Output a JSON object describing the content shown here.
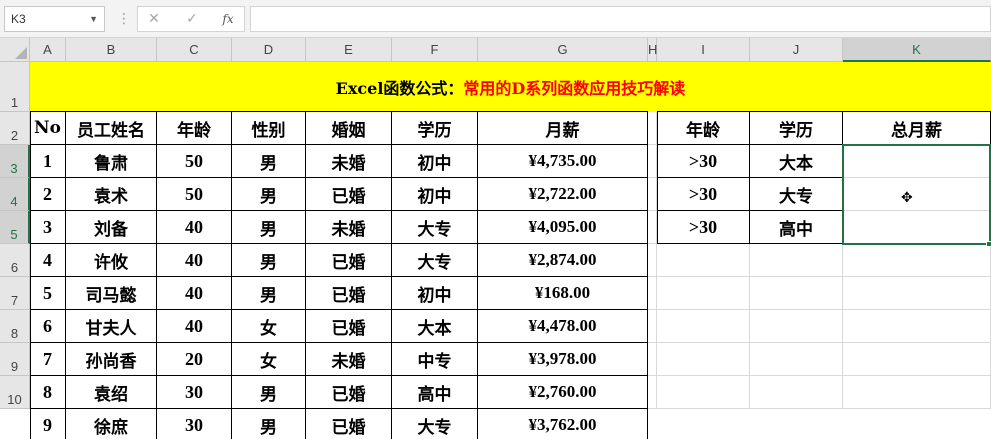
{
  "name_box": {
    "value": "K3"
  },
  "formula_bar": {
    "cancel_glyph": "✕",
    "enter_glyph": "✓",
    "fx_label": "fx",
    "formula": ""
  },
  "columns": [
    "A",
    "B",
    "C",
    "D",
    "E",
    "F",
    "G",
    "H",
    "I",
    "J",
    "K"
  ],
  "rows": [
    "1",
    "2",
    "3",
    "4",
    "5",
    "6",
    "7",
    "8",
    "9",
    "10"
  ],
  "selected_cell": "K3",
  "title": {
    "black_text": "Excel函数公式：",
    "red_text": "常用的D系列函数应用技巧解读"
  },
  "employee_table": {
    "headers": [
      "No",
      "员工姓名",
      "年龄",
      "性别",
      "婚姻",
      "学历",
      "月薪"
    ],
    "rows": [
      [
        "1",
        "鲁肃",
        "50",
        "男",
        "未婚",
        "初中",
        "¥4,735.00"
      ],
      [
        "2",
        "袁术",
        "50",
        "男",
        "已婚",
        "初中",
        "¥2,722.00"
      ],
      [
        "3",
        "刘备",
        "40",
        "男",
        "未婚",
        "大专",
        "¥4,095.00"
      ],
      [
        "4",
        "许攸",
        "40",
        "男",
        "已婚",
        "大专",
        "¥2,874.00"
      ],
      [
        "5",
        "司马懿",
        "40",
        "男",
        "已婚",
        "初中",
        "¥168.00"
      ],
      [
        "6",
        "甘夫人",
        "40",
        "女",
        "已婚",
        "大本",
        "¥4,478.00"
      ],
      [
        "7",
        "孙尚香",
        "20",
        "女",
        "未婚",
        "中专",
        "¥3,978.00"
      ],
      [
        "8",
        "袁绍",
        "30",
        "男",
        "已婚",
        "高中",
        "¥2,760.00"
      ],
      [
        "9",
        "徐庶",
        "30",
        "男",
        "已婚",
        "大专",
        "¥3,762.00"
      ]
    ]
  },
  "criteria_table": {
    "headers": [
      "年龄",
      "学历",
      "总月薪"
    ],
    "rows": [
      [
        ">30",
        "大本"
      ],
      [
        ">30",
        "大专"
      ],
      [
        ">30",
        "高中"
      ]
    ],
    "total_value": ""
  },
  "colors": {
    "title_fill": "#ffff00",
    "title_red": "#ff0000",
    "selection": "#217346"
  }
}
